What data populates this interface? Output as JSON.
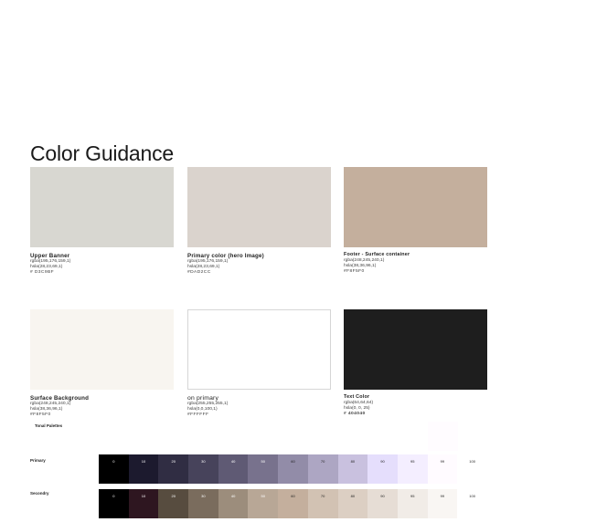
{
  "title": "Color Guidance",
  "swatches": [
    {
      "name": "Upper Banner",
      "color": "#D8D7D1",
      "lines": [
        "rgba(195,176,159,1)",
        "hsla(28,23,69,1)",
        "# D3C9BF"
      ]
    },
    {
      "name": "Primary color (hero Image)",
      "color": "#DAD3CD",
      "lines": [
        "rgba(195,176,159,1)",
        "hsla(28,23,69,1)",
        "#DAD2CC"
      ]
    },
    {
      "name": "Footer - Surface container",
      "color": "#C4AF9D",
      "lines": [
        "rgba(248,245,240,1)",
        "hsla(38,36,96,1)",
        "#F8F5F0"
      ]
    },
    {
      "name": "Surface Background",
      "color": "#F8F5F0",
      "lines": [
        "rgba(248,245,240,1)",
        "hsla(38,36,96,1)",
        "#F8F5F0"
      ]
    },
    {
      "name": "on primary",
      "color": "#FFFFFF",
      "lines": [
        "rgba(255,255,255,1)",
        "hsla(0,0,100,1)",
        "#FFFFFF"
      ]
    },
    {
      "name": "Text Color",
      "color": "#1E1E1E",
      "lines": [
        "rgba(64,64,64)",
        "hsla(0, 0, 25)",
        "# 404040"
      ]
    }
  ],
  "tonal": {
    "title": "Tonal Palettes",
    "primary": {
      "label": "Primary",
      "tones": [
        {
          "label": "0",
          "color": "#000000",
          "text": "#ffffff"
        },
        {
          "label": "10",
          "color": "#1c1a2e",
          "text": "#ffffff"
        },
        {
          "label": "20",
          "color": "#302d43",
          "text": "#ffffff"
        },
        {
          "label": "30",
          "color": "#47435b",
          "text": "#ffffff"
        },
        {
          "label": "40",
          "color": "#5f5a74",
          "text": "#ffffff"
        },
        {
          "label": "50",
          "color": "#78728d",
          "text": "#ffffff"
        },
        {
          "label": "60",
          "color": "#928ca8",
          "text": "#1e1e1e"
        },
        {
          "label": "70",
          "color": "#ada6c3",
          "text": "#1e1e1e"
        },
        {
          "label": "80",
          "color": "#c9c1df",
          "text": "#1e1e1e"
        },
        {
          "label": "90",
          "color": "#e5defc",
          "text": "#1e1e1e"
        },
        {
          "label": "95",
          "color": "#f4eeff",
          "text": "#1e1e1e"
        },
        {
          "label": "99",
          "color": "#fffbff",
          "text": "#1e1e1e"
        },
        {
          "label": "100",
          "color": "#ffffff",
          "text": "#1e1e1e"
        }
      ]
    },
    "secondary": {
      "label": "Secondry",
      "tones": [
        {
          "label": "0",
          "color": "#000000",
          "text": "#ffffff"
        },
        {
          "label": "10",
          "color": "#2e1620",
          "text": "#ffffff"
        },
        {
          "label": "20",
          "color": "#574c3f",
          "text": "#ffffff"
        },
        {
          "label": "30",
          "color": "#7a6c5d",
          "text": "#ffffff"
        },
        {
          "label": "40",
          "color": "#9c8d7c",
          "text": "#ffffff"
        },
        {
          "label": "50",
          "color": "#b8a796",
          "text": "#ffffff"
        },
        {
          "label": "60",
          "color": "#c4af9d",
          "text": "#1e1e1e"
        },
        {
          "label": "70",
          "color": "#d2c2b3",
          "text": "#1e1e1e"
        },
        {
          "label": "80",
          "color": "#dccfc3",
          "text": "#1e1e1e"
        },
        {
          "label": "90",
          "color": "#e6ddd5",
          "text": "#1e1e1e"
        },
        {
          "label": "95",
          "color": "#f1ece7",
          "text": "#1e1e1e"
        },
        {
          "label": "99",
          "color": "#f9f6f3",
          "text": "#1e1e1e"
        },
        {
          "label": "100",
          "color": "#ffffff",
          "text": "#1e1e1e"
        }
      ]
    }
  }
}
